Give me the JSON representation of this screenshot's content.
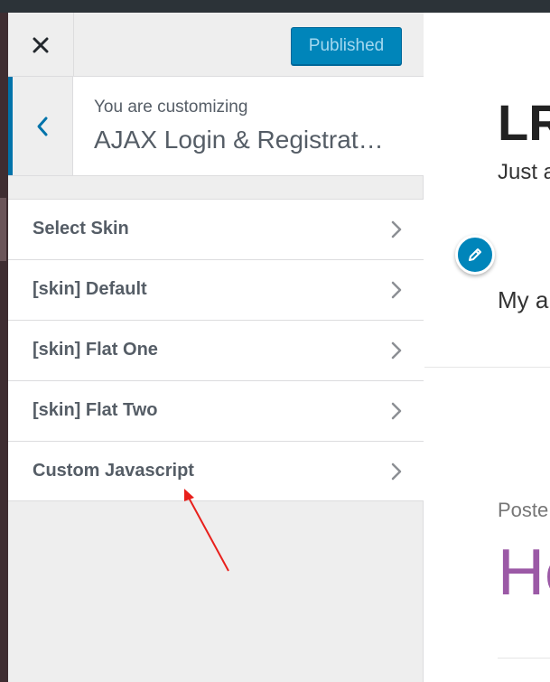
{
  "header": {
    "close_icon": "close-icon",
    "publish_label": "Published"
  },
  "info": {
    "back_icon": "chevron-left-icon",
    "customizing_label": "You are customizing",
    "site_title": "AJAX Login & Registrat…"
  },
  "sections": [
    {
      "label": "Select Skin"
    },
    {
      "label": "[skin] Default"
    },
    {
      "label": "[skin] Flat One"
    },
    {
      "label": "[skin] Flat Two"
    },
    {
      "label": "Custom Javascript"
    }
  ],
  "preview": {
    "site_title": "LR",
    "tagline": "Just a",
    "menu_text": "My a",
    "posted_text": "Poste",
    "post_title": "He",
    "edit_icon": "pencil-icon"
  },
  "colors": {
    "accent": "#0085ba",
    "back_accent": "#0073aa",
    "annotation_arrow": "#e8201c",
    "post_title": "#9b59a6"
  }
}
